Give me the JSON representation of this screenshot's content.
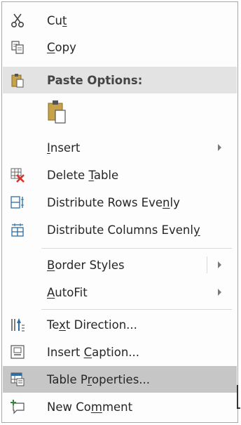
{
  "menu": {
    "items": [
      {
        "pre": "Cu",
        "key": "t",
        "post": "",
        "icon": "scissors-icon"
      },
      {
        "pre": "",
        "key": "C",
        "post": "opy",
        "icon": "copy-icon"
      },
      {
        "pre": "Paste Options:",
        "key": "",
        "post": "",
        "icon": "clipboard-icon"
      },
      {
        "icon": "paste-option-keep-formatting-icon"
      },
      {
        "pre": "",
        "key": "I",
        "post": "nsert",
        "icon": ""
      },
      {
        "pre": "Delete ",
        "key": "T",
        "post": "able",
        "icon": "delete-table-icon"
      },
      {
        "pre": "Distribute Rows Eve",
        "key": "n",
        "post": "ly",
        "icon": "distribute-rows-icon"
      },
      {
        "pre": "Distribute Columns Evenl",
        "key": "y",
        "post": "",
        "icon": "distribute-columns-icon"
      },
      {
        "pre": "",
        "key": "B",
        "post": "order Styles",
        "icon": ""
      },
      {
        "pre": "",
        "key": "A",
        "post": "utoFit",
        "icon": ""
      },
      {
        "pre": "Te",
        "key": "x",
        "post": "t Direction...",
        "icon": "text-direction-icon"
      },
      {
        "pre": "Insert ",
        "key": "C",
        "post": "aption...",
        "icon": "insert-caption-icon"
      },
      {
        "pre": "Table P",
        "key": "r",
        "post": "operties...",
        "icon": "table-properties-icon"
      },
      {
        "pre": "New Co",
        "key": "m",
        "post": "ment",
        "icon": "new-comment-icon"
      }
    ]
  },
  "colors": {
    "header_bg": "#e3e3e3",
    "highlight_bg": "#c6c6c6",
    "delete_red": "#d9342b",
    "clipboard_gold": "#c8a248"
  }
}
